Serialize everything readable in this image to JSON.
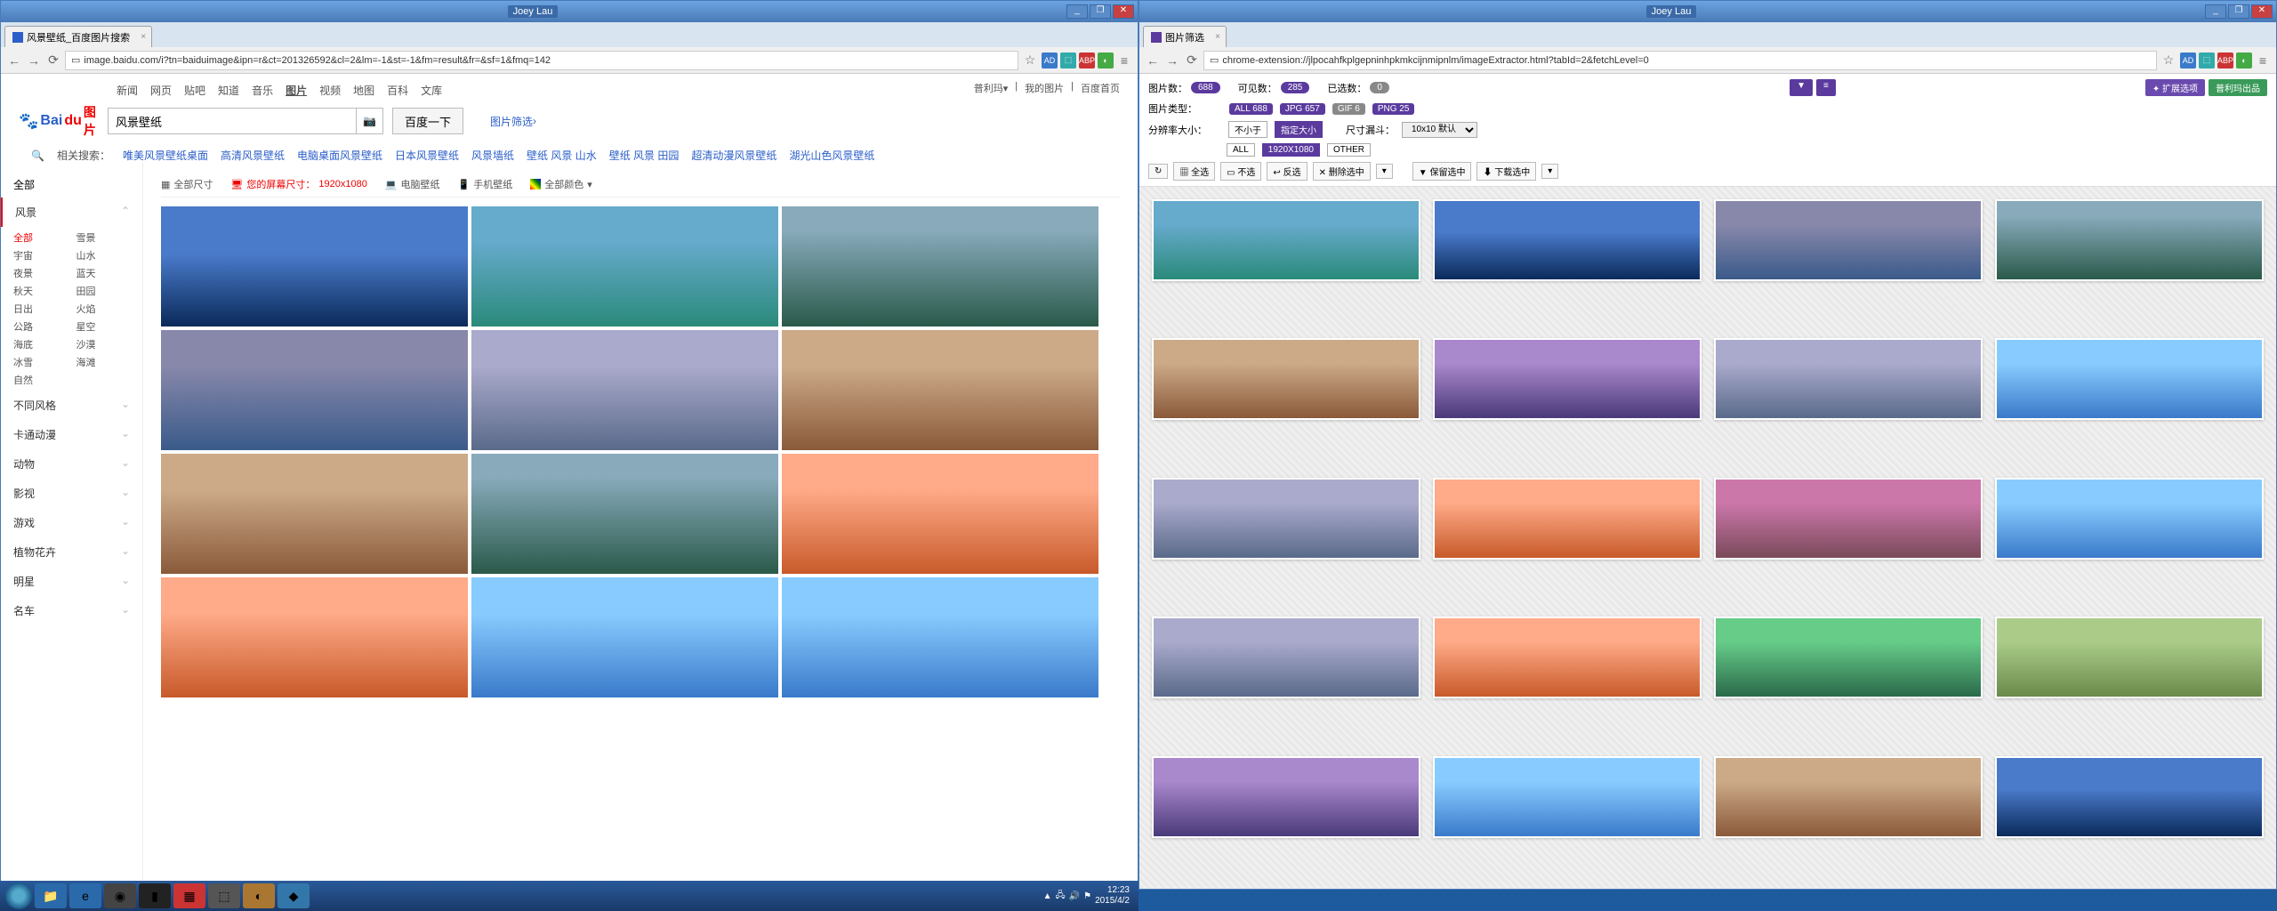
{
  "left": {
    "titlebar_user": "Joey Lau",
    "tab_title": "风景壁纸_百度图片搜索",
    "url": "image.baidu.com/i?tn=baiduimage&ipn=r&ct=201326592&cl=2&lm=-1&st=-1&fm=result&fr=&sf=1&fmq=142",
    "topnav": [
      "新闻",
      "网页",
      "贴吧",
      "知道",
      "音乐",
      "图片",
      "视频",
      "地图",
      "百科",
      "文库"
    ],
    "topnav_active": "图片",
    "toplinks": [
      "普利玛▾",
      "我的图片",
      "百度首页"
    ],
    "logo_a": "Bai",
    "logo_b": "du",
    "logo_c": "图片",
    "search_value": "风景壁纸",
    "search_btn": "百度一下",
    "adv": "图片筛选",
    "related_label": "相关搜索：",
    "related": [
      "唯美风景壁纸桌面",
      "高清风景壁纸",
      "电脑桌面风景壁纸",
      "日本风景壁纸",
      "风景墙纸",
      "壁纸 风景 山水",
      "壁纸 风景 田园",
      "超清动漫风景壁纸",
      "湖光山色风景壁纸"
    ],
    "sidebar_top": "全部",
    "sidebar_exp": "风景",
    "categories": [
      "全部",
      "雪景",
      "宇宙",
      "山水",
      "夜景",
      "蓝天",
      "秋天",
      "田园",
      "日出",
      "火焰",
      "公路",
      "星空",
      "海底",
      "沙漠",
      "冰雪",
      "海滩",
      "自然",
      ""
    ],
    "cat_selected": "全部",
    "sidebar_rest": [
      "不同风格",
      "卡通动漫",
      "动物",
      "影视",
      "游戏",
      "植物花卉",
      "明星",
      "名车"
    ],
    "toolbar": {
      "all_size": "全部尺寸",
      "your_screen": "您的屏幕尺寸：",
      "screen_res": "1920x1080",
      "pc_wall": "电脑壁纸",
      "mobile_wall": "手机壁纸",
      "all_color": "全部颜色"
    }
  },
  "right": {
    "titlebar_user": "Joey Lau",
    "tab_title": "图片筛选",
    "url": "chrome-extension://jlpocahfkplgepninhpkmkcijnmipnlm/imageExtractor.html?tabId=2&fetchLevel=0",
    "stats": {
      "total_label": "图片数：",
      "total": "688",
      "visible_label": "可见数：",
      "visible": "285",
      "selected_label": "已选数：",
      "selected": "0"
    },
    "topbtn1": "✦ 扩展选项",
    "topbtn2": "普利玛出品",
    "type_label": "图片类型：",
    "types": [
      {
        "name": "ALL",
        "count": "688"
      },
      {
        "name": "JPG",
        "count": "657"
      },
      {
        "name": "GIF",
        "count": "6"
      },
      {
        "name": "PNG",
        "count": "25"
      }
    ],
    "res_label": "分辨率大小：",
    "res_opts": [
      "不小于",
      "指定大小"
    ],
    "funnel_label": "尺寸漏斗：",
    "funnel_sel": "10x10 默认",
    "res2": [
      "ALL",
      "1920X1080",
      "OTHER"
    ],
    "actions": [
      "↻",
      "▦ 全选",
      "▭ 不选",
      "↩ 反选",
      "✕ 删除选中",
      "",
      "▼ 保留选中",
      "⬇ 下载选中"
    ]
  },
  "taskbar": {
    "time": "12:23",
    "date": "2015/4/2"
  }
}
